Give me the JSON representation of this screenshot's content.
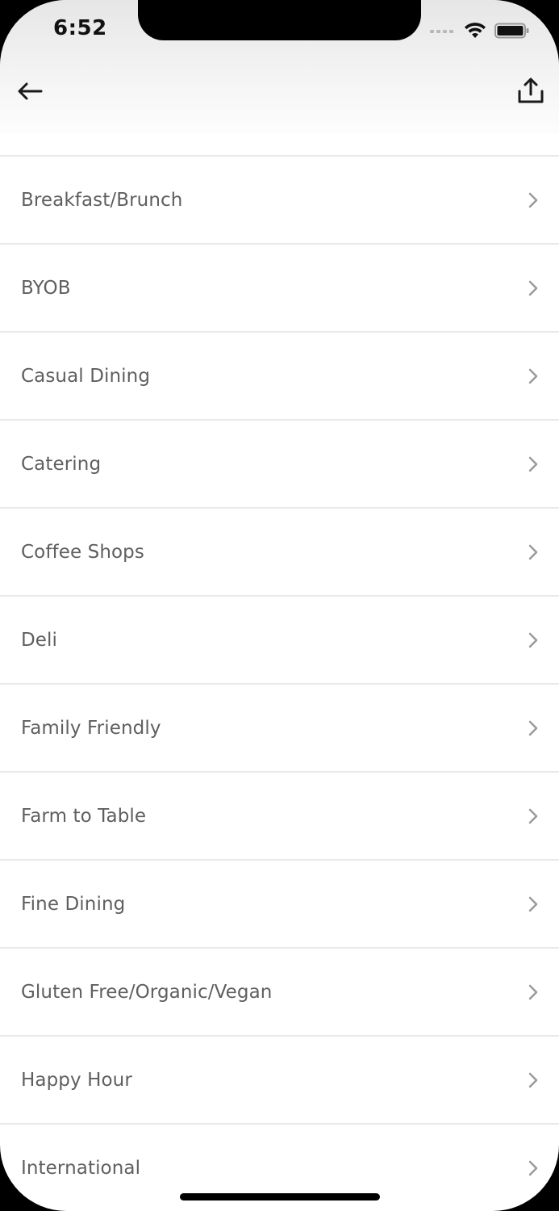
{
  "status_bar": {
    "time": "6:52"
  },
  "nav": {
    "back_icon": "arrow-left-icon",
    "share_icon": "share-upload-icon"
  },
  "categories": [
    {
      "label": "Breakfast/Brunch"
    },
    {
      "label": "BYOB"
    },
    {
      "label": "Casual Dining"
    },
    {
      "label": "Catering"
    },
    {
      "label": "Coffee Shops"
    },
    {
      "label": "Deli"
    },
    {
      "label": "Family Friendly"
    },
    {
      "label": "Farm to Table"
    },
    {
      "label": "Fine Dining"
    },
    {
      "label": "Gluten Free/Organic/Vegan"
    },
    {
      "label": "Happy Hour"
    },
    {
      "label": "International"
    }
  ],
  "colors": {
    "text": "#5f5f5f",
    "chevron": "#9a9a9a",
    "divider": "#e8e8e8"
  }
}
